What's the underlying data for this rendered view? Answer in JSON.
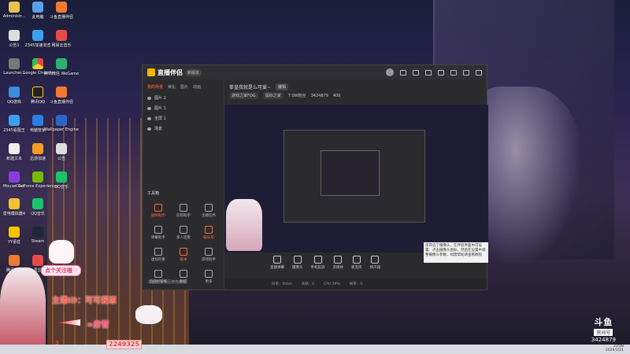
{
  "desktop": {
    "icons": [
      {
        "label": "Administr..."
      },
      {
        "label": "此电脑"
      },
      {
        "label": "斗鱼直播伴侣"
      },
      {
        "label": "公告1"
      },
      {
        "label": "2345加速浏览"
      },
      {
        "label": "网易云音乐"
      },
      {
        "label": "Launcher..."
      },
      {
        "label": "Google Chrome"
      },
      {
        "label": "腾讯微信 WeGame"
      },
      {
        "label": "QQ游戏"
      },
      {
        "label": "腾讯QQ"
      },
      {
        "label": "斗鱼直播伴侣"
      },
      {
        "label": "2345看图王"
      },
      {
        "label": "电脑管家"
      },
      {
        "label": "Wallpaper Engine"
      },
      {
        "label": "新建文本"
      },
      {
        "label": "迅游加速"
      },
      {
        "label": "公告"
      },
      {
        "label": "MouseClick"
      },
      {
        "label": "GeForce Experience"
      },
      {
        "label": "QQ音乐"
      },
      {
        "label": "雷电模拟器4"
      },
      {
        "label": "QQ音乐"
      },
      {
        "label": "YY语音"
      },
      {
        "label": "Steam"
      },
      {
        "label": "腾讯视频"
      },
      {
        "label": "爱剪"
      }
    ]
  },
  "app": {
    "logo_text": "直播伴侣",
    "logo_badge": "新版本",
    "sidebar": {
      "tabs": [
        "我的场景",
        "美化",
        "图片",
        "动画"
      ],
      "scenes": [
        "图片 2",
        "图片 1",
        "全屏 1",
        "场景"
      ],
      "tools_label": "工具箱",
      "tools": [
        {
          "label": "抽奖助手",
          "hot": true
        },
        {
          "label": "房管助手",
          "hot": false
        },
        {
          "label": "主播任务",
          "hot": false
        },
        {
          "label": "弹幕助手",
          "hot": false
        },
        {
          "label": "多人连麦",
          "hot": false
        },
        {
          "label": "娱乐玩",
          "hot": true
        },
        {
          "label": "虚拟形象",
          "hot": false
        },
        {
          "label": "脚本",
          "hot": true
        },
        {
          "label": "游戏助手",
          "hot": false
        },
        {
          "label": "直播间管理",
          "hot": false
        },
        {
          "label": "数据",
          "hot": false
        },
        {
          "label": "更多",
          "hot": false
        }
      ],
      "footer": "斗鱼直播伴侣使用教程"
    },
    "room": {
      "title": "拳皇我就是么可爱~",
      "edit": "编辑",
      "tag1": "游戏之家FOG",
      "tag2": "鼠标之家",
      "fans": "7.0W粉丝",
      "room_id": "3424879",
      "hot": "400"
    },
    "controls": [
      {
        "label": "直播弹幕"
      },
      {
        "label": "摄像头"
      },
      {
        "label": "手机投屏"
      },
      {
        "label": "多媒体"
      },
      {
        "label": "麦克风"
      },
      {
        "label": "扬声器"
      }
    ],
    "popup_text": "您开启了摄像头，在伴侣界面中可设置：点击摄像头图标，然后在设置中调整摄像头参数，如需帮助请查看教程",
    "status": [
      "码率：0kb/s",
      "丢帧：0",
      "CPU:39%",
      "帧率：0"
    ]
  },
  "overlay": {
    "follow_text": "点个关注嗷♡",
    "streamer_id": "主播ID：可可酱崽",
    "room_text": "=房管",
    "number_a": "3",
    "number_b": "2249325"
  },
  "douyu": {
    "logo": "斗鱼",
    "room_label": "房间号",
    "room_number": "3424879"
  },
  "clock": {
    "time": "23:08",
    "date": "2020/1/21"
  }
}
